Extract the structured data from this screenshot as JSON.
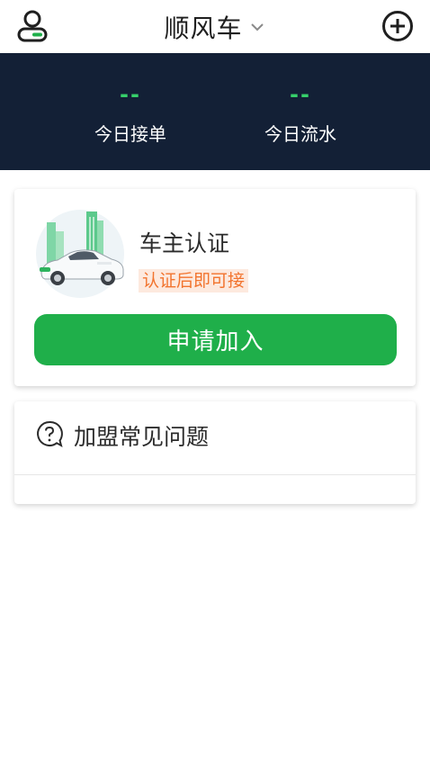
{
  "header": {
    "title": "顺风车",
    "icons": {
      "user": "user-profile-icon",
      "dropdown": "chevron-down-icon",
      "add": "plus-circle-icon"
    }
  },
  "stats": {
    "today_orders": {
      "value": "--",
      "label": "今日接单"
    },
    "today_flow": {
      "value": "--",
      "label": "今日流水"
    }
  },
  "auth_card": {
    "title": "车主认证",
    "tag": "认证后即可接",
    "button_label": "申请加入",
    "image": "car-illustration"
  },
  "faq_card": {
    "title": "加盟常见问题",
    "icon": "question-bubble-icon"
  },
  "colors": {
    "banner_bg": "#132036",
    "accent_green": "#1faf4a",
    "stat_green": "#36d06b",
    "tag_orange": "#f2742e",
    "tag_bg": "#fde9de"
  }
}
